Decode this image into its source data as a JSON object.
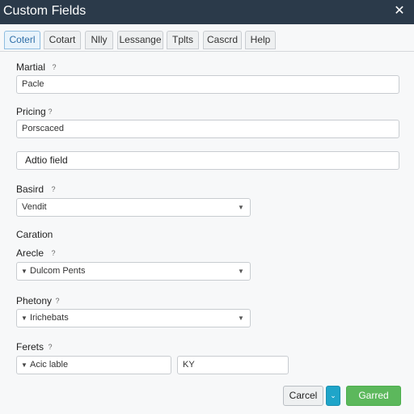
{
  "window": {
    "title": "Custom Fields",
    "close_glyph": "✕"
  },
  "tabs": [
    {
      "label": "Coterl",
      "active": true
    },
    {
      "label": "Cotart",
      "active": false
    },
    {
      "label": "Nlly",
      "active": false
    },
    {
      "label": "Lessange",
      "active": false
    },
    {
      "label": "Tplts",
      "active": false
    },
    {
      "label": "Cascrd",
      "active": false
    },
    {
      "label": "Help",
      "active": false
    }
  ],
  "form": {
    "help_glyph": "?",
    "martial": {
      "label": "Martial",
      "value": "Pacle"
    },
    "pricing": {
      "label": "Pricing",
      "value": "Porscaced"
    },
    "add_field": {
      "label": "Adtio field"
    },
    "basird": {
      "label": "Basird",
      "value": "Vendit"
    },
    "section_caration": "Caration",
    "arecle": {
      "label": "Arecle",
      "value": "Dulcom Pents"
    },
    "phetony": {
      "label": "Phetony",
      "value": "Irichebats"
    },
    "ferets": {
      "label": "Ferets",
      "value": "Acic lable",
      "value2": "KY"
    }
  },
  "footer": {
    "cancel_label": "Carcel",
    "split_glyph": "⌄",
    "primary_label": "Garred"
  },
  "colors": {
    "titlebar": "#2b3a4a",
    "accent": "#1fa5c9",
    "primary": "#5cb85c"
  }
}
